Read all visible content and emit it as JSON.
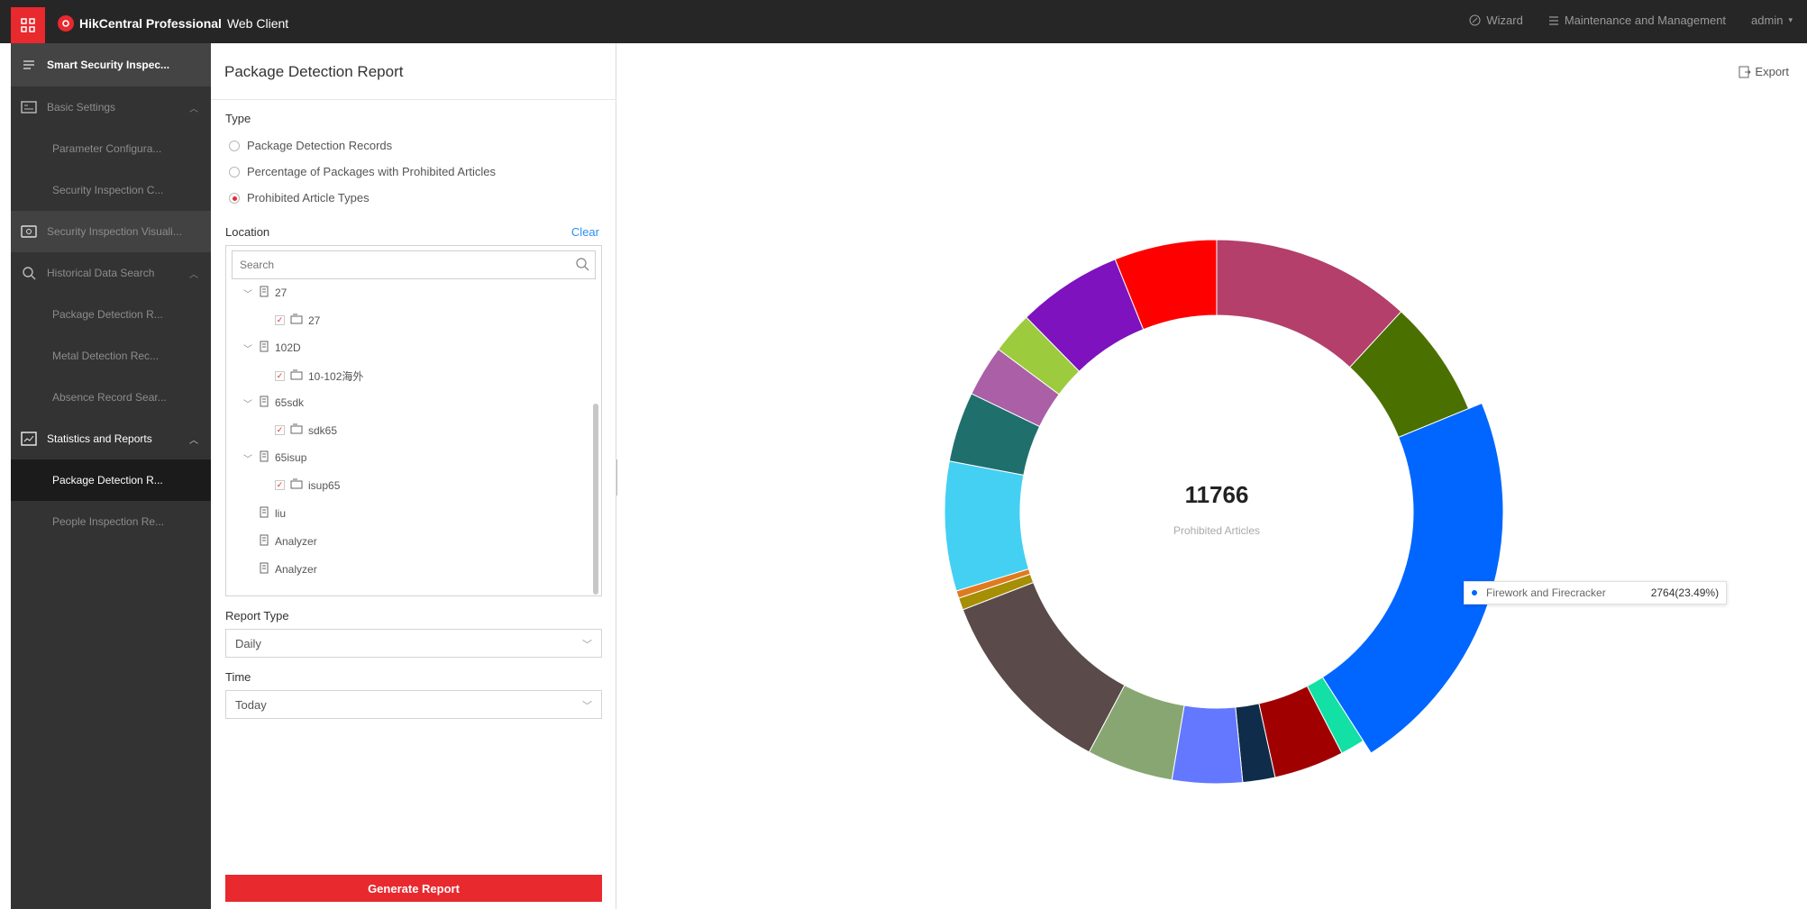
{
  "header": {
    "brand_bold": "HikCentral Professional",
    "brand_rest": "Web Client",
    "wizard": "Wizard",
    "maintenance": "Maintenance and Management",
    "user": "admin"
  },
  "nav": {
    "root": "Smart Security Inspec...",
    "items": [
      {
        "label": "Basic Settings"
      },
      {
        "label": "Parameter Configura..."
      },
      {
        "label": "Security Inspection C..."
      },
      {
        "label": "Security Inspection Visuali..."
      },
      {
        "label": "Historical Data Search"
      },
      {
        "label": "Package Detection R..."
      },
      {
        "label": "Metal Detection Rec..."
      },
      {
        "label": "Absence Record Sear..."
      },
      {
        "label": "Statistics and Reports"
      },
      {
        "label": "Package Detection R..."
      },
      {
        "label": "People Inspection Re..."
      }
    ]
  },
  "panel": {
    "title": "Package Detection Report",
    "type_label": "Type",
    "types": [
      {
        "label": "Package Detection Records",
        "selected": false
      },
      {
        "label": "Percentage of Packages with Prohibited Articles",
        "selected": false
      },
      {
        "label": "Prohibited Article Types",
        "selected": true
      }
    ],
    "location_label": "Location",
    "clear": "Clear",
    "search_placeholder": "Search",
    "tree": [
      {
        "label": "27"
      },
      {
        "label": "27"
      },
      {
        "label": "102D"
      },
      {
        "label": "10-102海外"
      },
      {
        "label": "65sdk"
      },
      {
        "label": "sdk65"
      },
      {
        "label": "65isup"
      },
      {
        "label": "isup65"
      },
      {
        "label": "liu"
      },
      {
        "label": "Analyzer"
      },
      {
        "label": "Analyzer"
      }
    ],
    "report_type_label": "Report Type",
    "report_type_value": "Daily",
    "time_label": "Time",
    "time_value": "Today",
    "generate": "Generate Report"
  },
  "main": {
    "export": "Export",
    "total": "11766",
    "total_label": "Prohibited Articles",
    "tooltip_name": "Firework and Firecracker",
    "tooltip_value": "2764(23.49%)"
  },
  "chart_data": {
    "type": "pie",
    "total": 11766,
    "slices": [
      {
        "value": 1480,
        "color": "#b33f6a"
      },
      {
        "value": 870,
        "color": "#4a7000"
      },
      {
        "value": 2764,
        "color": "#0066ff"
      },
      {
        "value": 180,
        "color": "#13e0a4"
      },
      {
        "value": 520,
        "color": "#a10000"
      },
      {
        "value": 240,
        "color": "#0f2d4b"
      },
      {
        "value": 520,
        "color": "#6378ff"
      },
      {
        "value": 640,
        "color": "#88a672"
      },
      {
        "value": 1420,
        "color": "#5a4a4a"
      },
      {
        "value": 90,
        "color": "#a68e05"
      },
      {
        "value": 55,
        "color": "#e07a1f"
      },
      {
        "value": 960,
        "color": "#44d0f2"
      },
      {
        "value": 520,
        "color": "#1f6f6d"
      },
      {
        "value": 380,
        "color": "#aa5fa6"
      },
      {
        "value": 310,
        "color": "#9ccb3d"
      },
      {
        "value": 780,
        "color": "#7d12be"
      },
      {
        "value": 760,
        "color": "#ff0000"
      }
    ],
    "highlight_index": 2
  }
}
